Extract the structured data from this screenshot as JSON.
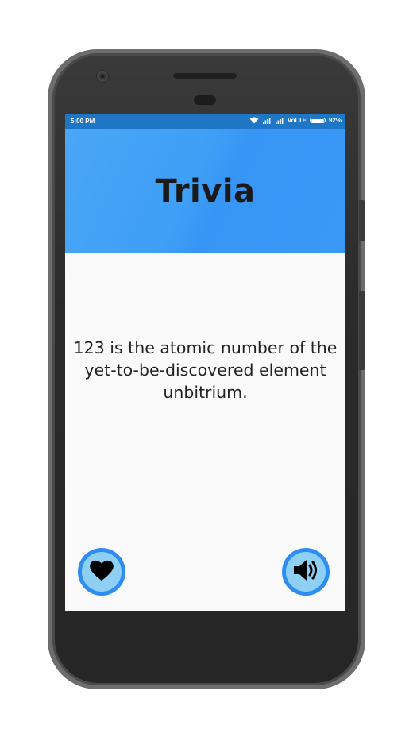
{
  "status_bar": {
    "time": "5:00 PM",
    "network": "VoLTE",
    "battery": "92%",
    "icons": [
      "wifi-icon",
      "signal-icon",
      "signal-icon",
      "battery-icon"
    ]
  },
  "header": {
    "title": "Trivia"
  },
  "fact": {
    "text": "123 is the atomic number of the yet-to-be-discovered element unbitrium."
  },
  "actions": {
    "favorite_icon": "heart-icon",
    "speak_icon": "speaker-icon"
  },
  "colors": {
    "status_bar": "#1e76c4",
    "header": "#3e9ff6",
    "button_ring": "#2f8cf0",
    "button_fill": "#8dd0f3",
    "background": "#fafafa"
  }
}
